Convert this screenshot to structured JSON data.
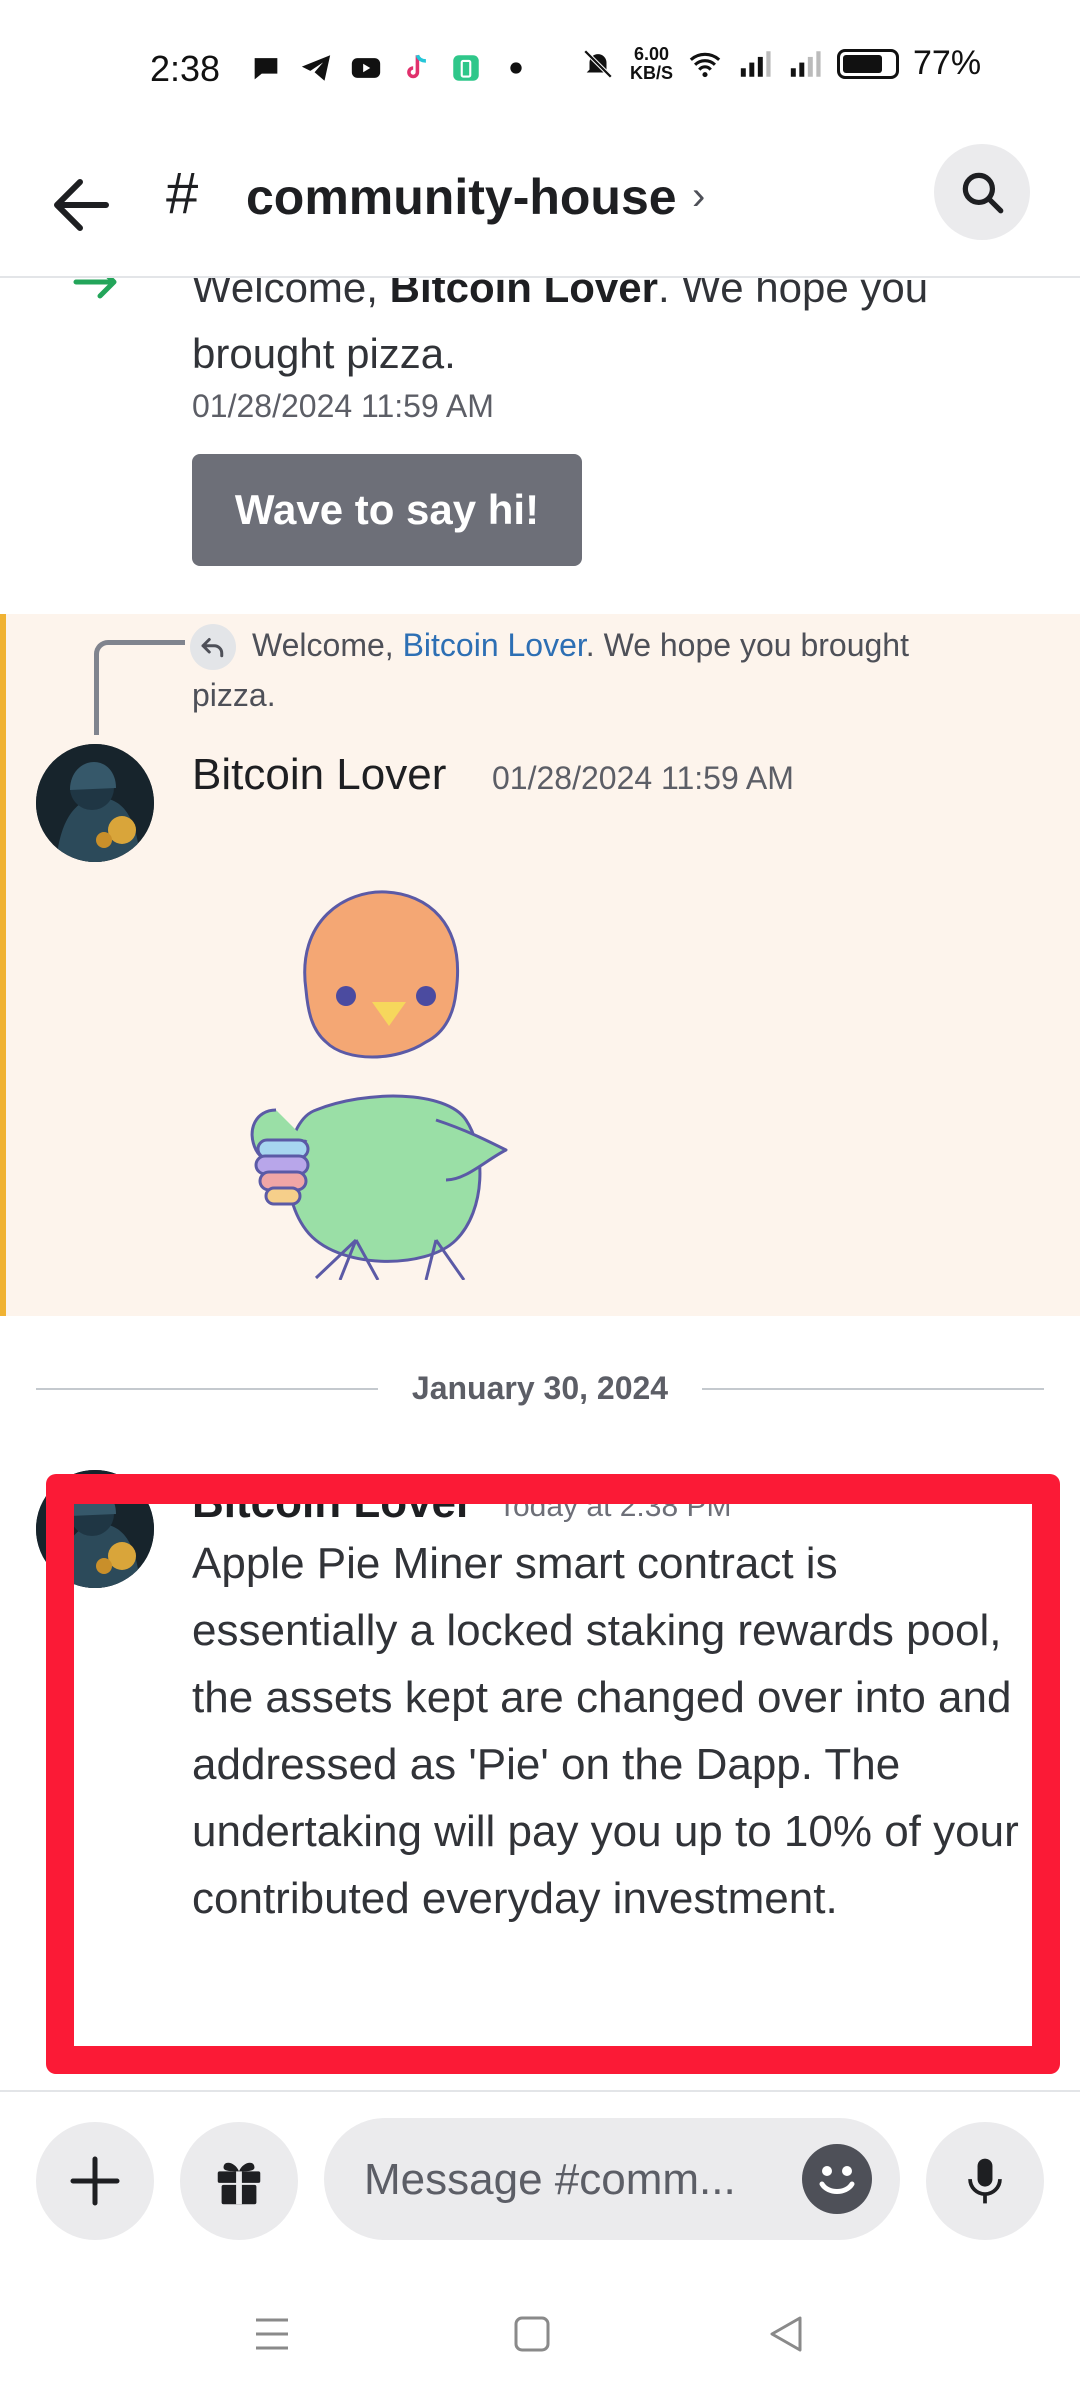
{
  "status_bar": {
    "time": "2:38",
    "net_speed_value": "6.00",
    "net_speed_unit": "KB/S",
    "battery": "77%"
  },
  "header": {
    "hash": "#",
    "channel": "community-house",
    "chevron": "›"
  },
  "messages": {
    "join_prefix": "Welcome, ",
    "join_user": "Bitcoin Lover",
    "join_suffix": ". We hope you brought pizza.",
    "join_time": "01/28/2024 11:59 AM",
    "wave_button": "Wave to say hi!",
    "reply_prefix": "Welcome, ",
    "reply_mention": "Bitcoin Lover",
    "reply_suffix": ". We hope you brought pizza.",
    "sticker_author": "Bitcoin Lover",
    "sticker_time": "01/28/2024 11:59 AM",
    "date_divider": "January 30, 2024",
    "latest_author": "Bitcoin Lover",
    "latest_time": "Today at 2:38 PM",
    "latest_body": "Apple Pie Miner smart contract is essentially a locked staking rewards pool, the assets kept are changed over into and addressed as 'Pie' on the Dapp. The undertaking will pay you up to 10% of your contributed everyday investment."
  },
  "composer": {
    "placeholder": "Message #comm..."
  },
  "colors": {
    "accent_green": "#23a55a",
    "highlight_bg": "#fdf4ec",
    "highlight_bar": "#f0b232",
    "annotation_red": "#fb1a36",
    "mention_blue": "#2d6fb4"
  },
  "icons": [
    "back-arrow-icon",
    "search-icon",
    "join-arrow-icon",
    "reply-icon",
    "plus-icon",
    "gift-icon",
    "emoji-icon",
    "microphone-icon",
    "menu-icon",
    "home-square-icon",
    "back-triangle-icon"
  ]
}
